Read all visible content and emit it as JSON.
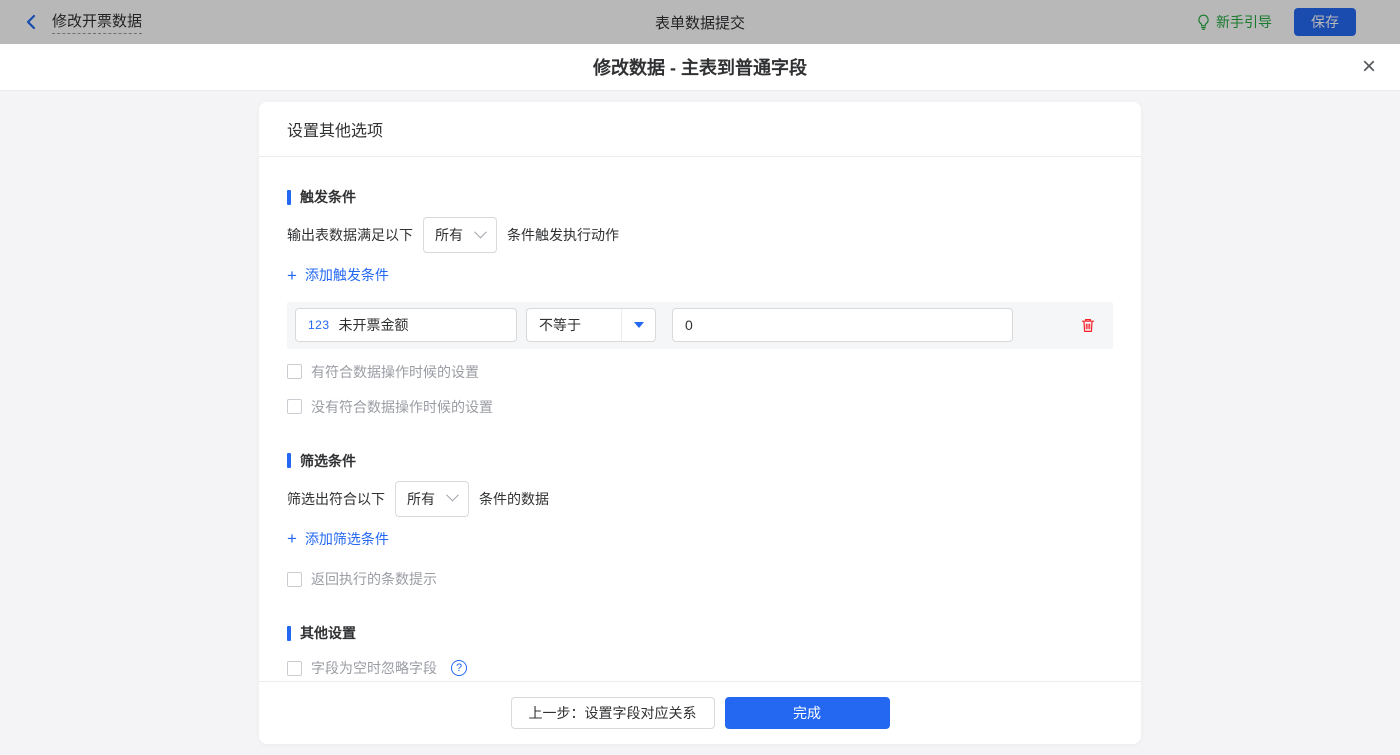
{
  "topbar": {
    "back_label": "修改开票数据",
    "center_title": "表单数据提交",
    "guide_label": "新手引导",
    "save_label": "保存"
  },
  "modal": {
    "title": "修改数据 - 主表到普通字段"
  },
  "card": {
    "header": "设置其他选项"
  },
  "trigger": {
    "title": "触发条件",
    "sentence_prefix": "输出表数据满足以下",
    "match_select": "所有",
    "sentence_suffix": "条件触发执行动作",
    "add_label": "添加触发条件",
    "condition": {
      "field_type_badge": "123",
      "field_name": "未开票金额",
      "operator": "不等于",
      "value": "0"
    },
    "has_match_checkbox": "有符合数据操作时候的设置",
    "no_match_checkbox": "没有符合数据操作时候的设置"
  },
  "filter": {
    "title": "筛选条件",
    "sentence_prefix": "筛选出符合以下",
    "match_select": "所有",
    "sentence_suffix": "条件的数据",
    "add_label": "添加筛选条件",
    "count_tip_checkbox": "返回执行的条数提示"
  },
  "other": {
    "title": "其他设置",
    "ignore_empty_checkbox": "字段为空时忽略字段"
  },
  "footer": {
    "prev_label": "上一步：设置字段对应关系",
    "done_label": "完成"
  },
  "icons": {
    "plus": "+",
    "close": "×",
    "question": "?"
  },
  "colors": {
    "accent": "#2468f2",
    "danger": "#f5222d",
    "guide_green": "#22a93f",
    "topbar_dimmed_bg": "#b3b3b3",
    "page_bg": "#f4f4f6"
  }
}
